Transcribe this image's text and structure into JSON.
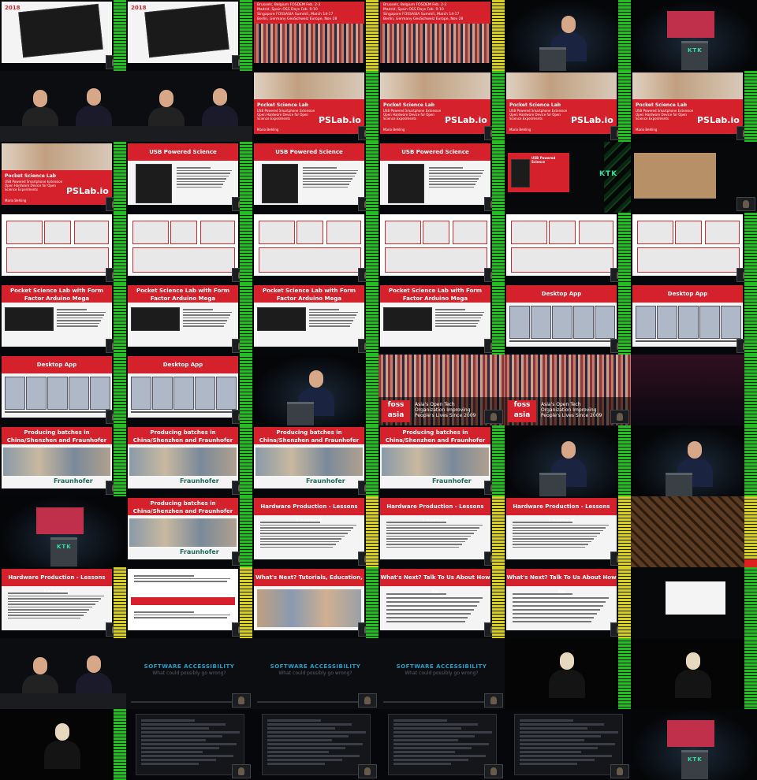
{
  "grid": {
    "columns": 6,
    "rows": 11
  },
  "texts": {
    "year": "2018",
    "event_lines": [
      "Brussels, Belgium FOSDEM Feb. 2-3",
      "Madrid, Spain OSS Days Feb. 9-10",
      "Singapore FOSSASIA Summit, March 14-17",
      "Berlin, Germany GeoSchweiz Europe, Nov 28"
    ],
    "psl_title": "Pocket Science Lab",
    "psl_sub": "USB Powered Smartphone Extension Open Hardware Device for Open Science Experiments",
    "psl_name": "Mario Behling",
    "usb_title": "USB Powered Science",
    "mega_title": "Pocket Science Lab with Form Factor Arduino Mega",
    "desktop_title": "Desktop App",
    "prod_title": "Producing batches in China/Shenzhen and Fraunhofer IZM in Germany Berlin",
    "fraunhofer": "Fraunhofer",
    "hw_title": "Hardware Production - Lessons Learned",
    "next_title": "What's Next? Tutorials, Education, Workshops",
    "talk_title": "What's Next? Talk To Us About How to",
    "soft_title": "SOFTWARE ACCESSIBILITY",
    "soft_sub": "What could possibly go wrong?",
    "foss_logo": "foss asia",
    "foss_text": "Asia's Open Tech Organization Improving People's Lives Since 2009",
    "kit_logo": "KTK",
    "pslab_logo": "PSLab.io"
  },
  "colors": {
    "accent": "#d4212c",
    "kit_green": "#2fe0a0",
    "soft_blue": "#1fa0c8"
  }
}
